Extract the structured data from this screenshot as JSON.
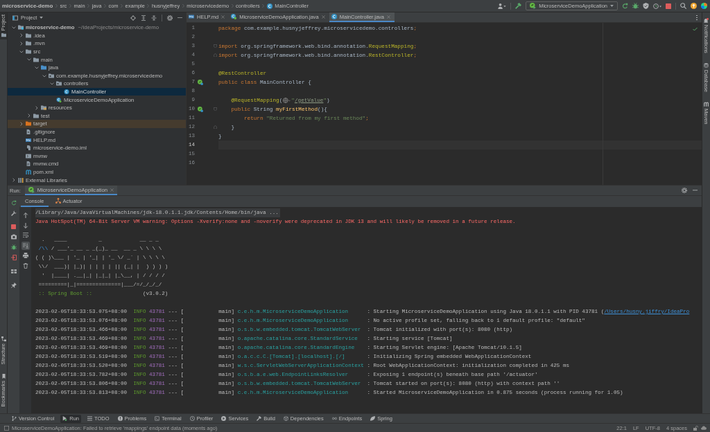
{
  "breadcrumbs": [
    {
      "label": "microservice-demo",
      "kind": "project"
    },
    {
      "label": "src",
      "kind": "folder"
    },
    {
      "label": "main",
      "kind": "folder"
    },
    {
      "label": "java",
      "kind": "folder"
    },
    {
      "label": "com",
      "kind": "folder"
    },
    {
      "label": "example",
      "kind": "folder"
    },
    {
      "label": "husnyjeffrey",
      "kind": "folder"
    },
    {
      "label": "microservicedemo",
      "kind": "folder"
    },
    {
      "label": "controllers",
      "kind": "folder"
    },
    {
      "label": "MainController",
      "kind": "class"
    }
  ],
  "toolbar": {
    "run_configuration": "MicroserviceDemoApplication"
  },
  "left_tool_windows": {
    "top": [
      {
        "label": "Project",
        "selected": true
      }
    ],
    "bottom": [
      {
        "label": "Structure",
        "selected": false
      },
      {
        "label": "Bookmarks",
        "selected": false
      }
    ]
  },
  "project_panel": {
    "title": "Project",
    "tree": [
      {
        "label": "microservice-demo",
        "path": "~/IdeaProjects/microservice-demo",
        "kind": "module",
        "expanded": true,
        "selected": false,
        "children": [
          {
            "label": ".idea",
            "kind": "folder",
            "expanded": false,
            "selected": false
          },
          {
            "label": ".mvn",
            "kind": "folder",
            "expanded": false,
            "selected": false
          },
          {
            "label": "src",
            "kind": "folder",
            "expanded": true,
            "selected": false,
            "children": [
              {
                "label": "main",
                "kind": "folder",
                "expanded": true,
                "selected": false,
                "children": [
                  {
                    "label": "java",
                    "kind": "source_folder",
                    "expanded": true,
                    "selected": false,
                    "children": [
                      {
                        "label": "com.example.husnyjeffrey.microservicedemo",
                        "kind": "package",
                        "expanded": true,
                        "selected": false,
                        "children": [
                          {
                            "label": "controllers",
                            "kind": "package",
                            "expanded": true,
                            "selected": false,
                            "children": [
                              {
                                "label": "MainController",
                                "kind": "class",
                                "selected": true
                              }
                            ]
                          },
                          {
                            "label": "MicroserviceDemoApplication",
                            "kind": "spring_class",
                            "selected": false
                          }
                        ]
                      }
                    ]
                  },
                  {
                    "label": "resources",
                    "kind": "resources_folder",
                    "expanded": false,
                    "selected": false
                  }
                ]
              },
              {
                "label": "test",
                "kind": "folder",
                "expanded": false,
                "selected": false
              }
            ]
          },
          {
            "label": "target",
            "kind": "excluded_folder",
            "expanded": false,
            "selected": false
          },
          {
            "label": ".gitignore",
            "kind": "file",
            "selected": false
          },
          {
            "label": "HELP.md",
            "kind": "markdown",
            "selected": false
          },
          {
            "label": "microservice-demo.iml",
            "kind": "iml",
            "selected": false
          },
          {
            "label": "mvnw",
            "kind": "script",
            "selected": false
          },
          {
            "label": "mvnw.cmd",
            "kind": "text_file",
            "selected": false
          },
          {
            "label": "pom.xml",
            "kind": "maven",
            "selected": false
          }
        ]
      },
      {
        "label": "External Libraries",
        "kind": "library",
        "expanded": false,
        "selected": false
      }
    ]
  },
  "editor": {
    "tabs": [
      {
        "label": "HELP.md",
        "kind": "markdown",
        "selected": false
      },
      {
        "label": "MicroserviceDemoApplication.java",
        "kind": "spring_class",
        "selected": false
      },
      {
        "label": "MainController.java",
        "kind": "class",
        "selected": true
      }
    ],
    "lines": [
      {
        "number": "1",
        "current": false,
        "gutter_icon": false,
        "fold_start": false,
        "fold_end": false,
        "tokens": [
          {
            "kind": "keyword",
            "text": "package"
          },
          {
            "kind": "plain",
            "text": " com.example.husnyjeffrey.microservicedemo.controllers"
          },
          {
            "kind": "keyword",
            "text": ";"
          }
        ]
      },
      {
        "number": "2",
        "current": false,
        "gutter_icon": false,
        "fold_start": false,
        "fold_end": false
      },
      {
        "number": "3",
        "current": false,
        "gutter_icon": false,
        "fold_start": true,
        "fold_end": false,
        "tokens": [
          {
            "kind": "keyword",
            "text": "import"
          },
          {
            "kind": "plain",
            "text": " org.springframework.web.bind.annotation."
          },
          {
            "kind": "annotation",
            "text": "RequestMapping"
          },
          {
            "kind": "keyword",
            "text": ";"
          }
        ]
      },
      {
        "number": "4",
        "current": false,
        "gutter_icon": false,
        "fold_start": false,
        "fold_end": true,
        "tokens": [
          {
            "kind": "keyword",
            "text": "import"
          },
          {
            "kind": "plain",
            "text": " org.springframework.web.bind.annotation."
          },
          {
            "kind": "annotation",
            "text": "RestController"
          },
          {
            "kind": "keyword",
            "text": ";"
          }
        ]
      },
      {
        "number": "5",
        "current": false,
        "gutter_icon": false,
        "fold_start": false,
        "fold_end": false
      },
      {
        "number": "6",
        "current": false,
        "gutter_icon": false,
        "fold_start": false,
        "fold_end": false,
        "tokens": [
          {
            "kind": "annotation",
            "text": "@RestController"
          }
        ]
      },
      {
        "number": "7",
        "current": false,
        "gutter_icon": true,
        "fold_start": false,
        "fold_end": false,
        "tokens": [
          {
            "kind": "keyword",
            "text": "public class"
          },
          {
            "kind": "plain",
            "text": " MainController {"
          }
        ]
      },
      {
        "number": "8",
        "current": false,
        "gutter_icon": false,
        "fold_start": false,
        "fold_end": false
      },
      {
        "number": "9",
        "current": false,
        "gutter_icon": false,
        "fold_start": false,
        "fold_end": false,
        "tokens": [
          {
            "kind": "annotation",
            "text": "    @RequestMapping"
          },
          {
            "kind": "plain",
            "text": "("
          },
          {
            "kind": "hint"
          },
          {
            "kind": "string",
            "text": "\""
          },
          {
            "kind": "url",
            "text": "/getValue"
          },
          {
            "kind": "string",
            "text": "\""
          },
          {
            "kind": "plain",
            "text": ")"
          }
        ]
      },
      {
        "number": "10",
        "current": false,
        "gutter_icon": true,
        "fold_start": true,
        "fold_end": false,
        "tokens": [
          {
            "kind": "keyword",
            "text": "    public"
          },
          {
            "kind": "plain",
            "text": " String "
          },
          {
            "kind": "method",
            "text": "myFirstMethod"
          },
          {
            "kind": "plain",
            "text": "(){"
          }
        ]
      },
      {
        "number": "11",
        "current": false,
        "gutter_icon": false,
        "fold_start": false,
        "fold_end": false,
        "tokens": [
          {
            "kind": "keyword",
            "text": "        return"
          },
          {
            "kind": "string",
            "text": " \"Returned from my first method\""
          },
          {
            "kind": "keyword",
            "text": ";"
          }
        ]
      },
      {
        "number": "12",
        "current": false,
        "gutter_icon": false,
        "fold_start": false,
        "fold_end": true,
        "tokens": [
          {
            "kind": "plain",
            "text": "    }"
          }
        ]
      },
      {
        "number": "13",
        "current": false,
        "gutter_icon": false,
        "fold_start": false,
        "fold_end": false,
        "tokens": [
          {
            "kind": "plain",
            "text": "}"
          }
        ]
      },
      {
        "number": "14",
        "current": true,
        "gutter_icon": false,
        "fold_start": false,
        "fold_end": false
      },
      {
        "number": "15",
        "current": false,
        "gutter_icon": false,
        "fold_start": false,
        "fold_end": false
      },
      {
        "number": "16",
        "current": false,
        "gutter_icon": false,
        "fold_start": false,
        "fold_end": false
      }
    ]
  },
  "right_tool_windows": [
    {
      "label": "Notifications",
      "selected": false
    },
    {
      "label": "Database",
      "selected": false
    },
    {
      "label": "Maven",
      "selected": false
    }
  ],
  "run_panel": {
    "label": "Run:",
    "tabs": [
      {
        "label": "MicroserviceDemoApplication",
        "selected": true
      }
    ],
    "subtabs": [
      {
        "label": "Console",
        "selected": true
      },
      {
        "label": "Actuator",
        "selected": false
      }
    ],
    "output": [
      {
        "kind": "command",
        "text": "/Library/Java/JavaVirtualMachines/jdk-18.0.1.1.jdk/Contents/Home/bin/java ..."
      },
      {
        "kind": "warning",
        "text": "Java HotSpot(TM) 64-Bit Server VM warning: Options -Xverify:none and -noverify were deprecated in JDK 13 and will likely be removed in a future release."
      },
      {
        "kind": "blank"
      },
      {
        "kind": "banner",
        "segments": [
          {
            "kind": "plain",
            "text": "  .   ____          _            __ _ _"
          }
        ]
      },
      {
        "kind": "banner",
        "segments": [
          {
            "kind": "link",
            "text": " /\\\\"
          },
          {
            "kind": "plain",
            "text": " / ___'_ __ _ _(_)_ __  __ _ \\ \\ \\ \\"
          }
        ]
      },
      {
        "kind": "banner",
        "segments": [
          {
            "kind": "plain",
            "text": "( ( )\\___ | '_ | '_| | '_ \\/ _` | \\ \\ \\ \\"
          }
        ]
      },
      {
        "kind": "banner",
        "segments": [
          {
            "kind": "plain",
            "text": " \\\\/  ___)| |_)| | | | | || (_| |  ) ) ) )"
          }
        ]
      },
      {
        "kind": "banner",
        "segments": [
          {
            "kind": "plain",
            "text": "  '  |____| .__|_| |_|_| |_\\__, | / / / /"
          }
        ]
      },
      {
        "kind": "banner",
        "segments": [
          {
            "kind": "plain",
            "text": " =========|_|==============|___/=/_/_/_/"
          }
        ]
      },
      {
        "kind": "banner",
        "segments": [
          {
            "kind": "label",
            "text": " :: Spring Boot ::"
          },
          {
            "kind": "plain",
            "text": "                (v3.0.2)"
          }
        ]
      },
      {
        "kind": "blank"
      }
    ],
    "log": [
      {
        "timestamp": "2023-02-05T18:33:53.075+08:00",
        "level": "INFO",
        "pid": "43781",
        "thread": "--- [           main]",
        "logger": "c.e.h.m.MicroserviceDemoApplication",
        "message": ": Starting MicroserviceDemoApplication using Java 18.0.1.1 with PID 43781 (",
        "link": "/Users/husny.jiffry/IdeaPro"
      },
      {
        "timestamp": "2023-02-05T18:33:53.076+08:00",
        "level": "INFO",
        "pid": "43781",
        "thread": "--- [           main]",
        "logger": "c.e.h.m.MicroserviceDemoApplication",
        "message": ": No active profile set, falling back to 1 default profile: \"default\""
      },
      {
        "timestamp": "2023-02-05T18:33:53.466+08:00",
        "level": "INFO",
        "pid": "43781",
        "thread": "--- [           main]",
        "logger": "o.s.b.w.embedded.tomcat.TomcatWebServer",
        "message": ": Tomcat initialized with port(s): 8080 (http)"
      },
      {
        "timestamp": "2023-02-05T18:33:53.469+08:00",
        "level": "INFO",
        "pid": "43781",
        "thread": "--- [           main]",
        "logger": "o.apache.catalina.core.StandardService",
        "message": ": Starting service [Tomcat]"
      },
      {
        "timestamp": "2023-02-05T18:33:53.469+08:00",
        "level": "INFO",
        "pid": "43781",
        "thread": "--- [           main]",
        "logger": "o.apache.catalina.core.StandardEngine",
        "message": ": Starting Servlet engine: [Apache Tomcat/10.1.5]"
      },
      {
        "timestamp": "2023-02-05T18:33:53.519+08:00",
        "level": "INFO",
        "pid": "43781",
        "thread": "--- [           main]",
        "logger": "o.a.c.c.C.[Tomcat].[localhost].[/]",
        "message": ": Initializing Spring embedded WebApplicationContext"
      },
      {
        "timestamp": "2023-02-05T18:33:53.520+08:00",
        "level": "INFO",
        "pid": "43781",
        "thread": "--- [           main]",
        "logger": "w.s.c.ServletWebServerApplicationContext",
        "message": ": Root WebApplicationContext: initialization completed in 425 ms"
      },
      {
        "timestamp": "2023-02-05T18:33:53.782+08:00",
        "level": "INFO",
        "pid": "43781",
        "thread": "--- [           main]",
        "logger": "o.s.b.a.e.web.EndpointLinksResolver",
        "message": ": Exposing 1 endpoint(s) beneath base path '/actuator'"
      },
      {
        "timestamp": "2023-02-05T18:33:53.806+08:00",
        "level": "INFO",
        "pid": "43781",
        "thread": "--- [           main]",
        "logger": "o.s.b.w.embedded.tomcat.TomcatWebServer",
        "message": ": Tomcat started on port(s): 8080 (http) with context path ''"
      },
      {
        "timestamp": "2023-02-05T18:33:53.813+08:00",
        "level": "INFO",
        "pid": "43781",
        "thread": "--- [           main]",
        "logger": "c.e.h.m.MicroserviceDemoApplication",
        "message": ": Started MicroserviceDemoApplication in 0.875 seconds (process running for 1.05)"
      }
    ]
  },
  "tool_window_bar": [
    {
      "label": "Version Control",
      "selected": false
    },
    {
      "label": "Run",
      "selected": true
    },
    {
      "label": "TODO",
      "selected": false
    },
    {
      "label": "Problems",
      "selected": false
    },
    {
      "label": "Terminal",
      "selected": false
    },
    {
      "label": "Profiler",
      "selected": false
    },
    {
      "label": "Services",
      "selected": false
    },
    {
      "label": "Build",
      "selected": false
    },
    {
      "label": "Dependencies",
      "selected": false
    },
    {
      "label": "Endpoints",
      "selected": false
    },
    {
      "label": "Spring",
      "selected": false
    }
  ],
  "status_bar": {
    "message": "MicroserviceDemoApplication: Failed to retrieve 'mappings' endpoint data (moments ago)",
    "items": [
      "22:1",
      "LF",
      "UTF-8",
      "4 spaces"
    ]
  }
}
